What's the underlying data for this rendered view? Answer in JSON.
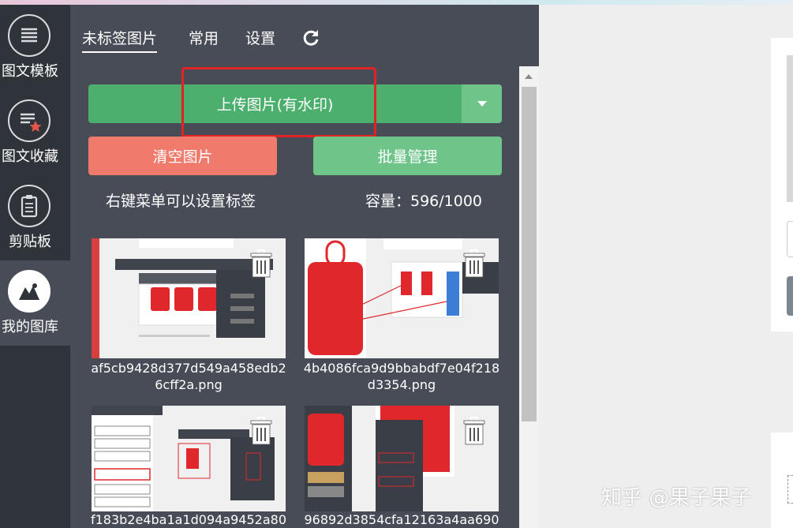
{
  "sidebar": {
    "items": [
      {
        "label": "图文模板",
        "icon": "template-list-icon",
        "active": false
      },
      {
        "label": "图文收藏",
        "icon": "favorites-star-icon",
        "active": false
      },
      {
        "label": "剪贴板",
        "icon": "clipboard-icon",
        "active": false
      },
      {
        "label": "我的图库",
        "icon": "gallery-image-icon",
        "active": true
      }
    ]
  },
  "tabs": [
    {
      "label": "未标签图片",
      "active": true
    },
    {
      "label": "常用",
      "active": false
    },
    {
      "label": "设置",
      "active": false
    }
  ],
  "refresh_icon": "refresh-icon",
  "buttons": {
    "upload": "上传图片(有水印)",
    "clear": "清空图片",
    "batch": "批量管理"
  },
  "hint": "右键菜单可以设置标签",
  "capacity": "容量：596/1000",
  "images": [
    {
      "filename": "af5cb9428d377d549a458edb26cff2a.png"
    },
    {
      "filename": "4b4086fca9d9bbabdf7e04f218d3354.png"
    },
    {
      "filename": "f183b2e4ba1a1d094a9452a80"
    },
    {
      "filename": "96892d3854cfa12163a4aa690"
    }
  ],
  "watermark": "知乎 @果子果子",
  "colors": {
    "sidebar_bg": "#2f343b",
    "panel_bg": "#474c56",
    "upload_green": "#4caf6d",
    "light_green": "#6fc48a",
    "clear_red": "#f07a6c",
    "highlight_red": "#e02424"
  }
}
